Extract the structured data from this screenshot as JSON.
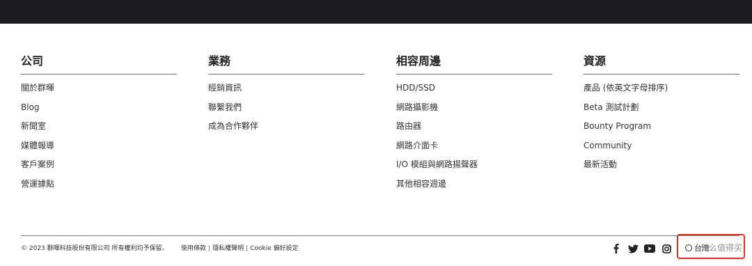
{
  "columns": [
    {
      "title": "公司",
      "links": [
        "關於群暉",
        "Blog",
        "新聞室",
        "媒體報導",
        "客戶案例",
        "營運據點"
      ]
    },
    {
      "title": "業務",
      "links": [
        "經銷資訊",
        "聯繫我們",
        "成為合作夥伴"
      ]
    },
    {
      "title": "相容周邊",
      "links": [
        "HDD/SSD",
        "網路攝影機",
        "路由器",
        "網路介面卡",
        "I/O 模組與網路揚聲器",
        "其他相容週邊"
      ]
    },
    {
      "title": "資源",
      "links": [
        "產品 (依英文字母排序)",
        "Beta 測試計劃",
        "Bounty Program",
        "Community",
        "最新活動"
      ]
    }
  ],
  "footer": {
    "copyright": "© 2023 群暉科技股份有限公司 所有權利均予保留。",
    "legal": [
      "使用條款",
      "隱私權聲明",
      "Cookie 偏好設定"
    ],
    "separator": "|",
    "social_icons": [
      "facebook-icon",
      "twitter-icon",
      "youtube-icon",
      "instagram-icon"
    ],
    "region_label": "台灣",
    "watermark_text": "什么值得买"
  },
  "colors": {
    "topbar": "#1b1d20",
    "highlight_box": "#e0322d",
    "text": "#2b2b2b"
  }
}
